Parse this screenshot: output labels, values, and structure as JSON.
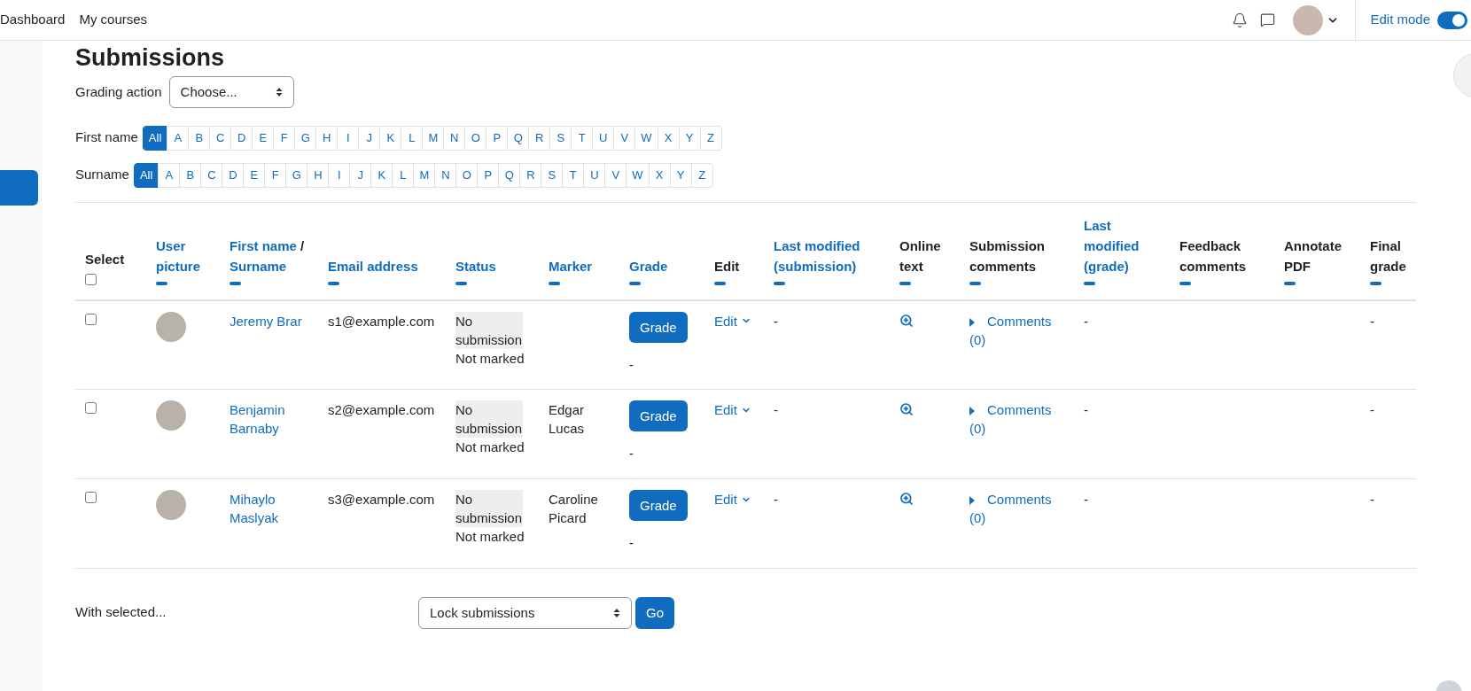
{
  "nav": {
    "links": [
      "Dashboard",
      "My courses"
    ],
    "edit_mode": {
      "label": "Edit mode",
      "on": true
    }
  },
  "page": {
    "title": "Submissions",
    "grading_action": {
      "label": "Grading action",
      "value": "Choose..."
    }
  },
  "filters": [
    {
      "label": "First name",
      "letters": [
        {
          "text": "All",
          "selected": true
        },
        {
          "text": "A",
          "selected": false
        },
        {
          "text": "B",
          "selected": false
        },
        {
          "text": "C",
          "selected": false
        },
        {
          "text": "D",
          "selected": false
        },
        {
          "text": "E",
          "selected": false
        },
        {
          "text": "F",
          "selected": false
        },
        {
          "text": "G",
          "selected": false
        },
        {
          "text": "H",
          "selected": false
        },
        {
          "text": "I",
          "selected": false
        },
        {
          "text": "J",
          "selected": false
        },
        {
          "text": "K",
          "selected": false
        },
        {
          "text": "L",
          "selected": false
        },
        {
          "text": "M",
          "selected": false
        },
        {
          "text": "N",
          "selected": false
        },
        {
          "text": "O",
          "selected": false
        },
        {
          "text": "P",
          "selected": false
        },
        {
          "text": "Q",
          "selected": false
        },
        {
          "text": "R",
          "selected": false
        },
        {
          "text": "S",
          "selected": false
        },
        {
          "text": "T",
          "selected": false
        },
        {
          "text": "U",
          "selected": false
        },
        {
          "text": "V",
          "selected": false
        },
        {
          "text": "W",
          "selected": false
        },
        {
          "text": "X",
          "selected": false
        },
        {
          "text": "Y",
          "selected": false
        },
        {
          "text": "Z",
          "selected": false
        }
      ]
    },
    {
      "label": "Surname",
      "letters": [
        {
          "text": "All",
          "selected": true
        },
        {
          "text": "A",
          "selected": false
        },
        {
          "text": "B",
          "selected": false
        },
        {
          "text": "C",
          "selected": false
        },
        {
          "text": "D",
          "selected": false
        },
        {
          "text": "E",
          "selected": false
        },
        {
          "text": "F",
          "selected": false
        },
        {
          "text": "G",
          "selected": false
        },
        {
          "text": "H",
          "selected": false
        },
        {
          "text": "I",
          "selected": false
        },
        {
          "text": "J",
          "selected": false
        },
        {
          "text": "K",
          "selected": false
        },
        {
          "text": "L",
          "selected": false
        },
        {
          "text": "M",
          "selected": false
        },
        {
          "text": "N",
          "selected": false
        },
        {
          "text": "O",
          "selected": false
        },
        {
          "text": "P",
          "selected": false
        },
        {
          "text": "Q",
          "selected": false
        },
        {
          "text": "R",
          "selected": false
        },
        {
          "text": "S",
          "selected": false
        },
        {
          "text": "T",
          "selected": false
        },
        {
          "text": "U",
          "selected": false
        },
        {
          "text": "V",
          "selected": false
        },
        {
          "text": "W",
          "selected": false
        },
        {
          "text": "X",
          "selected": false
        },
        {
          "text": "Y",
          "selected": false
        },
        {
          "text": "Z",
          "selected": false
        }
      ]
    }
  ],
  "table": {
    "select_all": {
      "label": "Select",
      "checked": false
    },
    "columns": [
      {
        "label": "User picture",
        "sortable": true
      },
      {
        "label": "First name",
        "separator": "/",
        "label2": "Surname",
        "sortable": true
      },
      {
        "label": "Email address",
        "sortable": true
      },
      {
        "label": "Status",
        "sortable": true
      },
      {
        "label": "Marker",
        "sortable": true
      },
      {
        "label": "Grade",
        "sortable": true
      },
      {
        "label": "Edit",
        "sortable": false
      },
      {
        "label": "Last modified (submission)",
        "sortable": true
      },
      {
        "label": "Online text",
        "sortable": false
      },
      {
        "label": "Submission comments",
        "sortable": false
      },
      {
        "label": "Last modified (grade)",
        "sortable": true
      },
      {
        "label": "Feedback comments",
        "sortable": false
      },
      {
        "label": "Annotate PDF",
        "sortable": false
      },
      {
        "label": "Final grade",
        "sortable": false
      }
    ],
    "rows": [
      {
        "selected": false,
        "name": "Jeremy Brar",
        "email": "s1@example.com",
        "status": "No submission",
        "grading_status": "Not marked",
        "grade_button": "Grade",
        "grade": "-",
        "edit": "Edit",
        "last_modified_submission": "-",
        "comments": "Comments (0)",
        "last_modified_grade": "-",
        "final_grade": "-"
      },
      {
        "selected": false,
        "name": "Benjamin Barnaby",
        "email": "s2@example.com",
        "status": "No submission",
        "grading_status": "Not marked",
        "marker": "Edgar Lucas",
        "grade_button": "Grade",
        "grade": "-",
        "edit": "Edit",
        "last_modified_submission": "-",
        "comments": "Comments (0)",
        "last_modified_grade": "-",
        "final_grade": "-"
      },
      {
        "selected": false,
        "name": "Mihaylo Maslyak",
        "email": "s3@example.com",
        "status": "No submission",
        "grading_status": "Not marked",
        "marker": "Caroline Picard",
        "grade_button": "Grade",
        "grade": "-",
        "edit": "Edit",
        "last_modified_submission": "-",
        "comments": "Comments (0)",
        "last_modified_grade": "-",
        "final_grade": "-"
      }
    ]
  },
  "bulk": {
    "label": "With selected...",
    "value": "Lock submissions",
    "button": "Go"
  }
}
